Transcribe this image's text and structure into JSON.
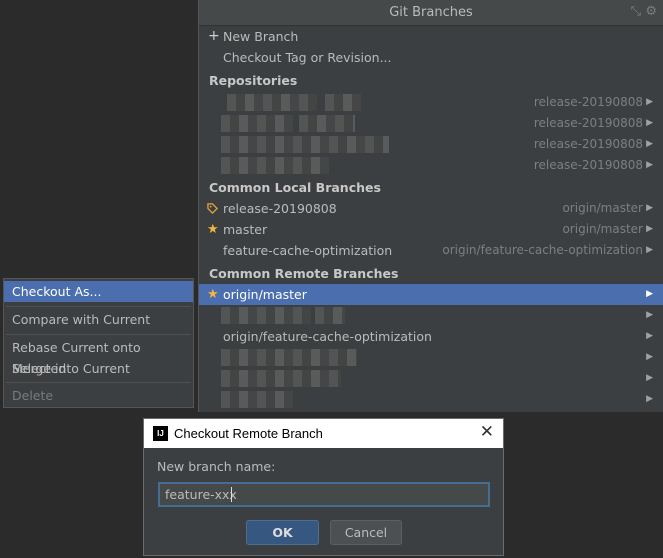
{
  "popup": {
    "title": "Git Branches",
    "actions": {
      "new_branch": "New Branch",
      "checkout_tag": "Checkout Tag or Revision..."
    },
    "sections": {
      "repositories": "Repositories",
      "common_local": "Common Local Branches",
      "common_remote": "Common Remote Branches"
    },
    "repositories": [
      {
        "tracking": "release-20190808"
      },
      {
        "tracking": "release-20190808"
      },
      {
        "tracking": "release-20190808"
      },
      {
        "tracking": "release-20190808"
      }
    ],
    "local_branches": [
      {
        "name": "release-20190808",
        "tracking": "origin/master",
        "icon": "tag-icon"
      },
      {
        "name": "master",
        "tracking": "origin/master",
        "icon": "star-icon"
      },
      {
        "name": "feature-cache-optimization",
        "tracking": "origin/feature-cache-optimization"
      }
    ],
    "remote_branches": [
      {
        "name": "origin/master",
        "icon": "star-icon",
        "selected": true
      },
      {
        "name": ""
      },
      {
        "name": "origin/feature-cache-optimization"
      },
      {
        "name": ""
      },
      {
        "name": ""
      },
      {
        "name": ""
      }
    ]
  },
  "context_menu": {
    "items": [
      {
        "label": "Checkout As...",
        "selected": true
      },
      {
        "label": "Compare with Current"
      },
      {
        "label": "Rebase Current onto Selected"
      },
      {
        "label": "Merge into Current"
      },
      {
        "label": "Delete",
        "disabled": true
      }
    ]
  },
  "dialog": {
    "title": "Checkout Remote Branch",
    "app_icon_text": "IJ",
    "field_label": "New branch name:",
    "field_value": "feature-xxx",
    "ok_label": "OK",
    "cancel_label": "Cancel"
  },
  "colors": {
    "selection": "#4b6eaf",
    "popup_bg": "#3c3f41",
    "star": "#f4b53f",
    "ok_button": "#365880"
  }
}
